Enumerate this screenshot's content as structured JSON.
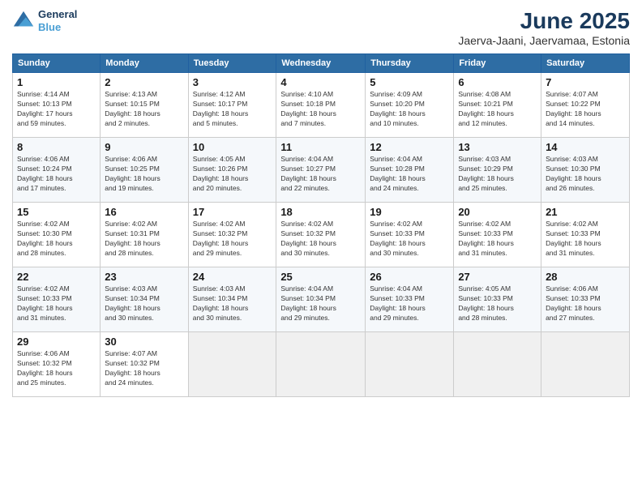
{
  "logo": {
    "line1": "General",
    "line2": "Blue"
  },
  "title": "June 2025",
  "subtitle": "Jaerva-Jaani, Jaervamaa, Estonia",
  "headers": [
    "Sunday",
    "Monday",
    "Tuesday",
    "Wednesday",
    "Thursday",
    "Friday",
    "Saturday"
  ],
  "rows": [
    [
      {
        "day": "1",
        "info": "Sunrise: 4:14 AM\nSunset: 10:13 PM\nDaylight: 17 hours\nand 59 minutes."
      },
      {
        "day": "2",
        "info": "Sunrise: 4:13 AM\nSunset: 10:15 PM\nDaylight: 18 hours\nand 2 minutes."
      },
      {
        "day": "3",
        "info": "Sunrise: 4:12 AM\nSunset: 10:17 PM\nDaylight: 18 hours\nand 5 minutes."
      },
      {
        "day": "4",
        "info": "Sunrise: 4:10 AM\nSunset: 10:18 PM\nDaylight: 18 hours\nand 7 minutes."
      },
      {
        "day": "5",
        "info": "Sunrise: 4:09 AM\nSunset: 10:20 PM\nDaylight: 18 hours\nand 10 minutes."
      },
      {
        "day": "6",
        "info": "Sunrise: 4:08 AM\nSunset: 10:21 PM\nDaylight: 18 hours\nand 12 minutes."
      },
      {
        "day": "7",
        "info": "Sunrise: 4:07 AM\nSunset: 10:22 PM\nDaylight: 18 hours\nand 14 minutes."
      }
    ],
    [
      {
        "day": "8",
        "info": "Sunrise: 4:06 AM\nSunset: 10:24 PM\nDaylight: 18 hours\nand 17 minutes."
      },
      {
        "day": "9",
        "info": "Sunrise: 4:06 AM\nSunset: 10:25 PM\nDaylight: 18 hours\nand 19 minutes."
      },
      {
        "day": "10",
        "info": "Sunrise: 4:05 AM\nSunset: 10:26 PM\nDaylight: 18 hours\nand 20 minutes."
      },
      {
        "day": "11",
        "info": "Sunrise: 4:04 AM\nSunset: 10:27 PM\nDaylight: 18 hours\nand 22 minutes."
      },
      {
        "day": "12",
        "info": "Sunrise: 4:04 AM\nSunset: 10:28 PM\nDaylight: 18 hours\nand 24 minutes."
      },
      {
        "day": "13",
        "info": "Sunrise: 4:03 AM\nSunset: 10:29 PM\nDaylight: 18 hours\nand 25 minutes."
      },
      {
        "day": "14",
        "info": "Sunrise: 4:03 AM\nSunset: 10:30 PM\nDaylight: 18 hours\nand 26 minutes."
      }
    ],
    [
      {
        "day": "15",
        "info": "Sunrise: 4:02 AM\nSunset: 10:30 PM\nDaylight: 18 hours\nand 28 minutes."
      },
      {
        "day": "16",
        "info": "Sunrise: 4:02 AM\nSunset: 10:31 PM\nDaylight: 18 hours\nand 28 minutes."
      },
      {
        "day": "17",
        "info": "Sunrise: 4:02 AM\nSunset: 10:32 PM\nDaylight: 18 hours\nand 29 minutes."
      },
      {
        "day": "18",
        "info": "Sunrise: 4:02 AM\nSunset: 10:32 PM\nDaylight: 18 hours\nand 30 minutes."
      },
      {
        "day": "19",
        "info": "Sunrise: 4:02 AM\nSunset: 10:33 PM\nDaylight: 18 hours\nand 30 minutes."
      },
      {
        "day": "20",
        "info": "Sunrise: 4:02 AM\nSunset: 10:33 PM\nDaylight: 18 hours\nand 31 minutes."
      },
      {
        "day": "21",
        "info": "Sunrise: 4:02 AM\nSunset: 10:33 PM\nDaylight: 18 hours\nand 31 minutes."
      }
    ],
    [
      {
        "day": "22",
        "info": "Sunrise: 4:02 AM\nSunset: 10:33 PM\nDaylight: 18 hours\nand 31 minutes."
      },
      {
        "day": "23",
        "info": "Sunrise: 4:03 AM\nSunset: 10:34 PM\nDaylight: 18 hours\nand 30 minutes."
      },
      {
        "day": "24",
        "info": "Sunrise: 4:03 AM\nSunset: 10:34 PM\nDaylight: 18 hours\nand 30 minutes."
      },
      {
        "day": "25",
        "info": "Sunrise: 4:04 AM\nSunset: 10:34 PM\nDaylight: 18 hours\nand 29 minutes."
      },
      {
        "day": "26",
        "info": "Sunrise: 4:04 AM\nSunset: 10:33 PM\nDaylight: 18 hours\nand 29 minutes."
      },
      {
        "day": "27",
        "info": "Sunrise: 4:05 AM\nSunset: 10:33 PM\nDaylight: 18 hours\nand 28 minutes."
      },
      {
        "day": "28",
        "info": "Sunrise: 4:06 AM\nSunset: 10:33 PM\nDaylight: 18 hours\nand 27 minutes."
      }
    ],
    [
      {
        "day": "29",
        "info": "Sunrise: 4:06 AM\nSunset: 10:32 PM\nDaylight: 18 hours\nand 25 minutes."
      },
      {
        "day": "30",
        "info": "Sunrise: 4:07 AM\nSunset: 10:32 PM\nDaylight: 18 hours\nand 24 minutes."
      },
      {
        "day": "",
        "info": ""
      },
      {
        "day": "",
        "info": ""
      },
      {
        "day": "",
        "info": ""
      },
      {
        "day": "",
        "info": ""
      },
      {
        "day": "",
        "info": ""
      }
    ]
  ]
}
